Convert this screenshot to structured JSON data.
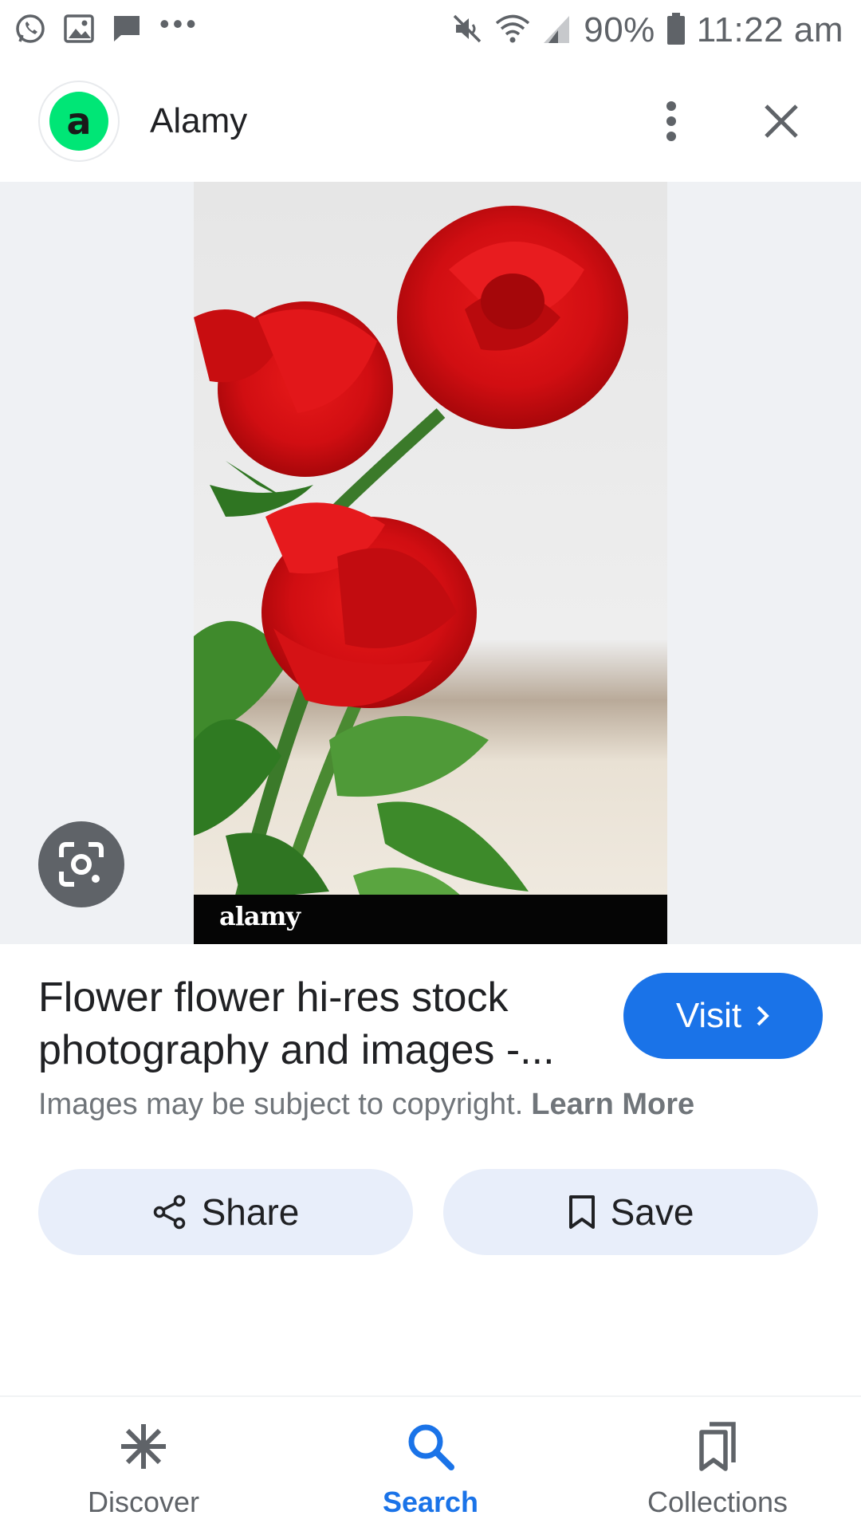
{
  "status_bar": {
    "battery": "90%",
    "time": "11:22 am",
    "left_icons": [
      "whatsapp-icon",
      "gallery-icon",
      "message-icon",
      "more-notifications-icon"
    ],
    "right_icons": [
      "mute-icon",
      "wifi-icon",
      "signal-icon",
      "battery-icon"
    ]
  },
  "header": {
    "favicon_letter": "a",
    "site_name": "Alamy",
    "more_icon": "more-vert-icon",
    "close_icon": "close-icon"
  },
  "image": {
    "watermark_brand": "alamy",
    "lens_icon": "google-lens-icon"
  },
  "result": {
    "title_line1": "Flower flower hi-res stock",
    "title_line2": "photography and images -...",
    "visit_label": "Visit",
    "copyright_text": "Images may be subject to copyright.",
    "learn_more_label": "Learn More"
  },
  "actions": {
    "share_label": "Share",
    "save_label": "Save"
  },
  "bottom_nav": {
    "items": [
      {
        "label": "Discover",
        "icon": "asterisk-icon",
        "active": false
      },
      {
        "label": "Search",
        "icon": "search-icon",
        "active": true
      },
      {
        "label": "Collections",
        "icon": "collections-icon",
        "active": false
      }
    ]
  },
  "colors": {
    "accent": "#1a73e8",
    "favicon_bg": "#00e676",
    "image_bg": "#eff1f4",
    "action_bg": "#e8eefa"
  }
}
